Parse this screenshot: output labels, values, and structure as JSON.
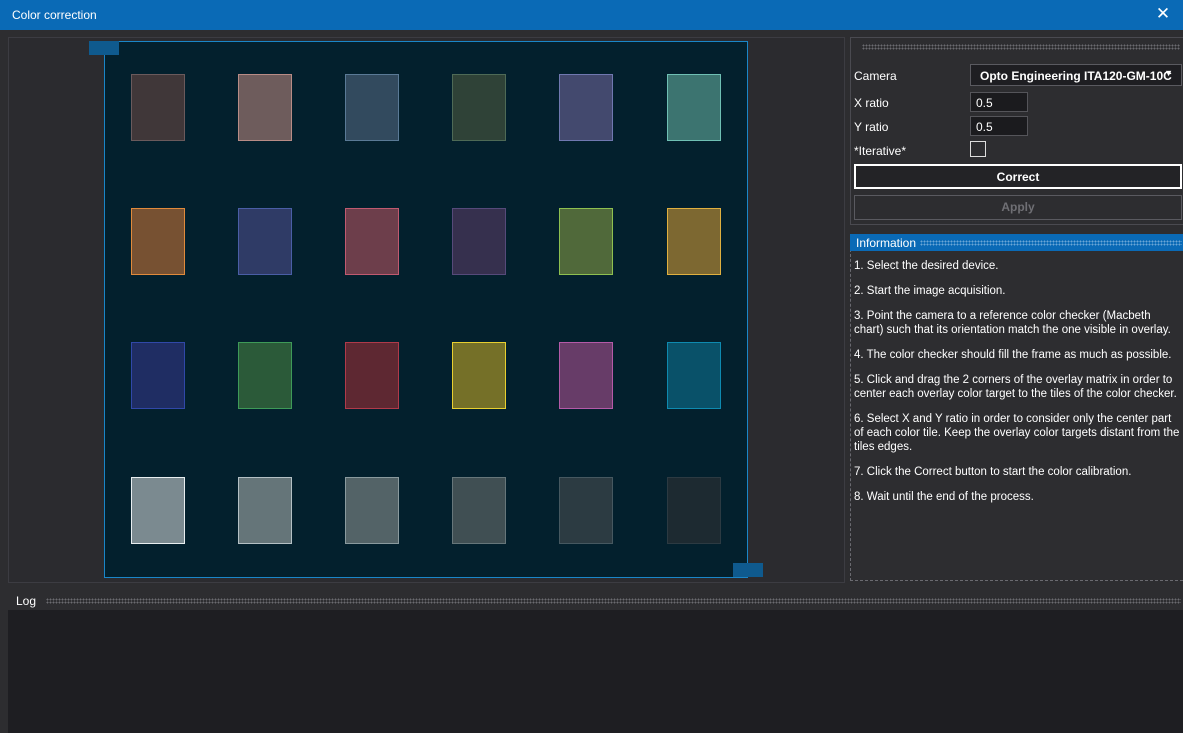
{
  "window": {
    "title": "Color correction",
    "close_glyph": "✕"
  },
  "tiles": [
    {
      "fill": "#403739",
      "border": "#6a5a5c"
    },
    {
      "fill": "#6e5c5c",
      "border": "#b88c86"
    },
    {
      "fill": "#324a5e",
      "border": "#5a7a96"
    },
    {
      "fill": "#2f4237",
      "border": "#4e6a56"
    },
    {
      "fill": "#43496e",
      "border": "#7078b0"
    },
    {
      "fill": "#3c7470",
      "border": "#6fc0b4"
    },
    {
      "fill": "#775132",
      "border": "#e08a3c"
    },
    {
      "fill": "#2f3b66",
      "border": "#4a5ea6"
    },
    {
      "fill": "#6d3e4b",
      "border": "#c05a70"
    },
    {
      "fill": "#36304e",
      "border": "#564a7a"
    },
    {
      "fill": "#50693a",
      "border": "#8ec050"
    },
    {
      "fill": "#7d6831",
      "border": "#e0b040"
    },
    {
      "fill": "#1f2d63",
      "border": "#3048a8"
    },
    {
      "fill": "#2b5a39",
      "border": "#3e9a58"
    },
    {
      "fill": "#5e2832",
      "border": "#b03a4a"
    },
    {
      "fill": "#757028",
      "border": "#e8d030"
    },
    {
      "fill": "#673c68",
      "border": "#b45aa8"
    },
    {
      "fill": "#095169",
      "border": "#0e8ab0"
    },
    {
      "fill": "#7b8a90",
      "border": "#e8eef0"
    },
    {
      "fill": "#657579",
      "border": "#b4c0c4"
    },
    {
      "fill": "#536367",
      "border": "#8a9a9e"
    },
    {
      "fill": "#404f53",
      "border": "#66767a"
    },
    {
      "fill": "#2c3b42",
      "border": "#465860"
    },
    {
      "fill": "#1d2a31",
      "border": "#2c3a42"
    }
  ],
  "settings": {
    "camera_label": "Camera",
    "camera_value": "Opto Engineering ITA120-GM-10C",
    "camera_caret": "▼",
    "x_ratio_label": "X ratio",
    "x_ratio_value": "0.5",
    "y_ratio_label": "Y ratio",
    "y_ratio_value": "0.5",
    "iterative_label": "*Iterative*",
    "iterative_checked": false,
    "correct_label": "Correct",
    "apply_label": "Apply"
  },
  "information": {
    "title": "Information",
    "steps": [
      "1. Select the desired device.",
      "2. Start the image acquisition.",
      "3. Point the camera to a reference color checker (Macbeth chart) such that its orientation match the one visible in overlay.",
      "4. The color checker should fill the frame as much as possible.",
      "5. Click and drag the 2 corners of the overlay matrix in order to center each overlay color target to the tiles of the color checker.",
      "6. Select X and Y ratio in order to consider only the center part of each color tile. Keep the overlay color targets distant from the tiles edges.",
      "7. Click the Correct button to start the color calibration.",
      "8. Wait until the end of the process."
    ]
  },
  "log": {
    "title": "Log",
    "content": ""
  }
}
